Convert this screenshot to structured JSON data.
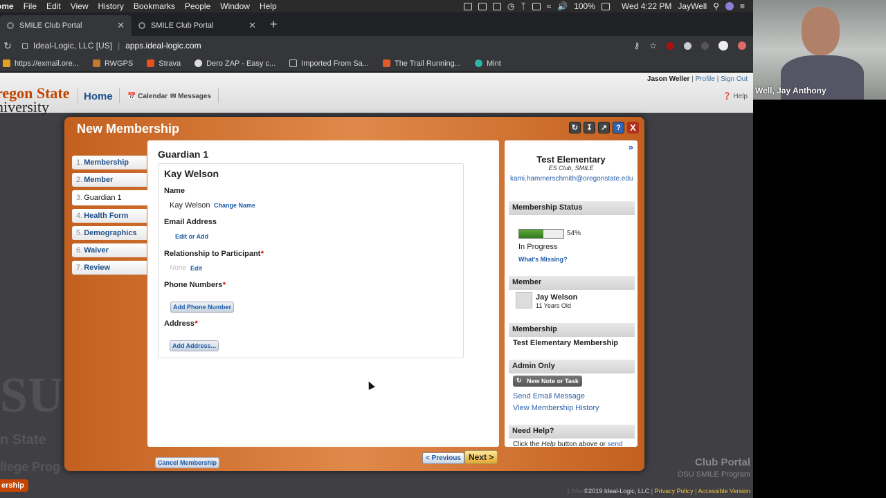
{
  "menubar": {
    "items": [
      "ome",
      "File",
      "Edit",
      "View",
      "History",
      "Bookmarks",
      "People",
      "Window",
      "Help"
    ],
    "battery": "100%",
    "clock": "Wed 4:22 PM",
    "user": "JayWell"
  },
  "browser": {
    "tabs": [
      {
        "title": "SMILE Club Portal"
      },
      {
        "title": "SMILE Club Portal"
      }
    ],
    "site_identity": "Ideal-Logic, LLC [US]",
    "url": "apps.ideal-logic.com",
    "bookmarks": [
      "https://exmail.ore...",
      "RWGPS",
      "Strava",
      "Dero ZAP - Easy c...",
      "Imported From Sa...",
      "The Trail Running...",
      "Mint"
    ]
  },
  "site": {
    "logo_line1": "regon State",
    "logo_line2": "niversity",
    "home": "Home",
    "calendar": "Calendar",
    "messages": "Messages",
    "user_name": "Jason Weller",
    "profile": "Profile",
    "sign_out": "Sign Out",
    "help": "Help",
    "bg_osu": "SU",
    "bg_state": "n State",
    "bg_college": "llege Prog",
    "bg_club_portal": "Club Portal",
    "bg_club_program": "OSU SMILE Program",
    "footer_version": "1.66a",
    "footer_copy": "©2019 Ideal-Logic, LLC",
    "footer_privacy": "Privacy Policy",
    "footer_accessible": "Accessible Version",
    "corner_tab": "ership"
  },
  "modal": {
    "title": "New Membership",
    "steps": [
      {
        "num": "1.",
        "label": "Membership"
      },
      {
        "num": "2.",
        "label": "Member"
      },
      {
        "num": "3.",
        "label": "Guardian 1"
      },
      {
        "num": "4.",
        "label": "Health Form"
      },
      {
        "num": "5.",
        "label": "Demographics"
      },
      {
        "num": "6.",
        "label": "Waiver"
      },
      {
        "num": "7.",
        "label": "Review"
      }
    ],
    "section_title": "Guardian 1",
    "guardian_name": "Kay Welson",
    "name_label": "Name",
    "name_value": "Kay Welson",
    "change_name": "Change Name",
    "email_label": "Email Address",
    "edit_or_add": "Edit or Add",
    "relationship_label": "Relationship to Participant",
    "relationship_value": "None",
    "relationship_edit": "Edit",
    "phone_label": "Phone Numbers",
    "add_phone": "Add Phone Number",
    "address_label": "Address",
    "add_address": "Add Address...",
    "required_mark": "*",
    "cancel": "Cancel Membership",
    "previous": "< Previous",
    "next": "Next >"
  },
  "sidebar": {
    "collapse": "»",
    "org_name": "Test Elementary",
    "org_sub": "ES Club, SMILE",
    "org_email": "kami.hammerschmith@oregonstate.edu",
    "status_head": "Membership Status",
    "progress_percent": 54,
    "progress_label": "54%",
    "status_text": "In Progress",
    "whats_missing": "What's Missing?",
    "member_head": "Member",
    "member_name": "Jay Welson",
    "member_age": "11 Years Old",
    "membership_head": "Membership",
    "membership_name": "Test Elementary Membership",
    "admin_head": "Admin Only",
    "new_note": "New Note or Task",
    "send_email": "Send Email Message",
    "view_history": "View Membership History",
    "need_help_head": "Need Help?",
    "need_help_text_1": "Click the",
    "need_help_text_help": "Help",
    "need_help_text_2": "button above or",
    "need_help_text_send": "send"
  },
  "webcam": {
    "participant": "Well, Jay Anthony"
  }
}
